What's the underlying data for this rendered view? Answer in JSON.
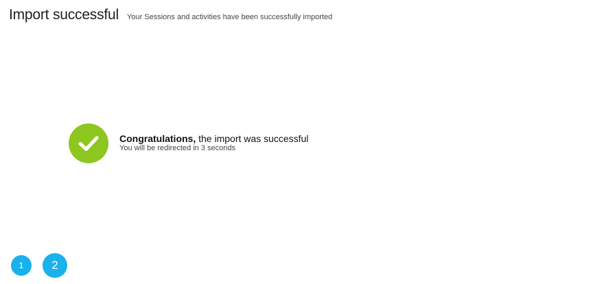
{
  "header": {
    "title": "Import successful",
    "subtitle": "Your Sessions and activities have been successfully imported"
  },
  "result": {
    "icon": "check-icon",
    "icon_color": "#8cc61f",
    "headline_bold": "Congratulations,",
    "headline_rest": " the import was successful",
    "redirect_text": "You will be redirected in 3 seconds"
  },
  "steps": {
    "accent_color": "#1ab1ec",
    "items": [
      {
        "label": "1"
      },
      {
        "label": "2"
      }
    ]
  }
}
